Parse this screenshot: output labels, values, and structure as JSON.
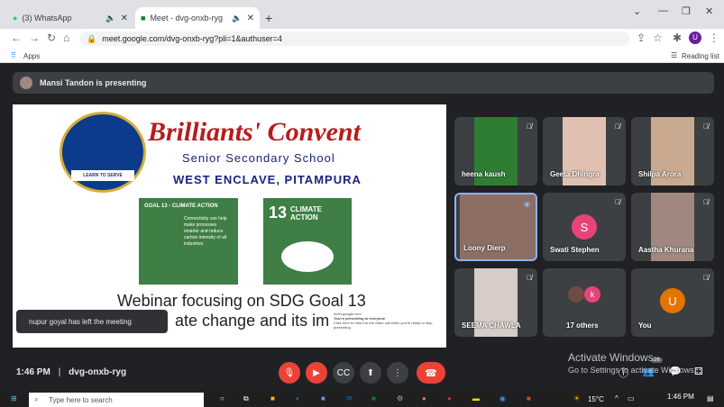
{
  "browser": {
    "tabs": [
      {
        "title": "(3) WhatsApp",
        "active": false
      },
      {
        "title": "Meet - dvg-onxb-ryg",
        "active": true
      }
    ],
    "url": "meet.google.com/dvg-onxb-ryg?pli=1&authuser=4",
    "bookmarks_apps": "Apps",
    "reading_list": "Reading list",
    "profile_initial": "U"
  },
  "meet": {
    "presenting_banner": "Mansi Tandon is presenting",
    "slide": {
      "title": "Brilliants' Convent",
      "subtitle1": "Senior Secondary School",
      "subtitle2": "WEST ENCLAVE, PITAMPURA",
      "goal_box_title": "GOAL 13 - CLIMATE ACTION",
      "goal_box_text": "Connectivity can help make processes smarter and reduce carbon intensity of all industries",
      "goal_number": "13",
      "goal_label": "CLIMATE ACTION",
      "webinar_text": "Webinar focusing on SDG Goal 13",
      "webinar_text2": "ate change and its impa",
      "logo_motto": "LEARN TO SERVE"
    },
    "mini_popup": {
      "site": "meet.google.com",
      "line1": "You're presenting to everyone",
      "line2": "Click here to return to the video call when you're ready to stop presenting"
    },
    "toast": "nupur goyal has left the meeting",
    "participants": [
      {
        "name": "heena kaush",
        "type": "video"
      },
      {
        "name": "Geeta Dhingra",
        "type": "video"
      },
      {
        "name": "Shilpa Arora",
        "type": "video"
      },
      {
        "name": "Loony Dierp",
        "type": "video",
        "speaking": true
      },
      {
        "name": "Swati Stephen",
        "type": "avatar",
        "initial": "S",
        "color": "#e8447a"
      },
      {
        "name": "Aastha Khurana",
        "type": "video"
      },
      {
        "name": "SEEMA CHAWLA",
        "type": "video"
      },
      {
        "name": "17 others",
        "type": "group",
        "initial": "k"
      },
      {
        "name": "You",
        "type": "avatar",
        "initial": "U",
        "color": "#e37400"
      }
    ],
    "time": "1:46 PM",
    "meeting_code": "dvg-onxb-ryg",
    "people_count": "26"
  },
  "windows": {
    "activate_title": "Activate Windows",
    "activate_sub": "Go to Settings to activate Windows.",
    "search_placeholder": "Type here to search",
    "temperature": "15°C",
    "clock": "1:46 PM"
  }
}
